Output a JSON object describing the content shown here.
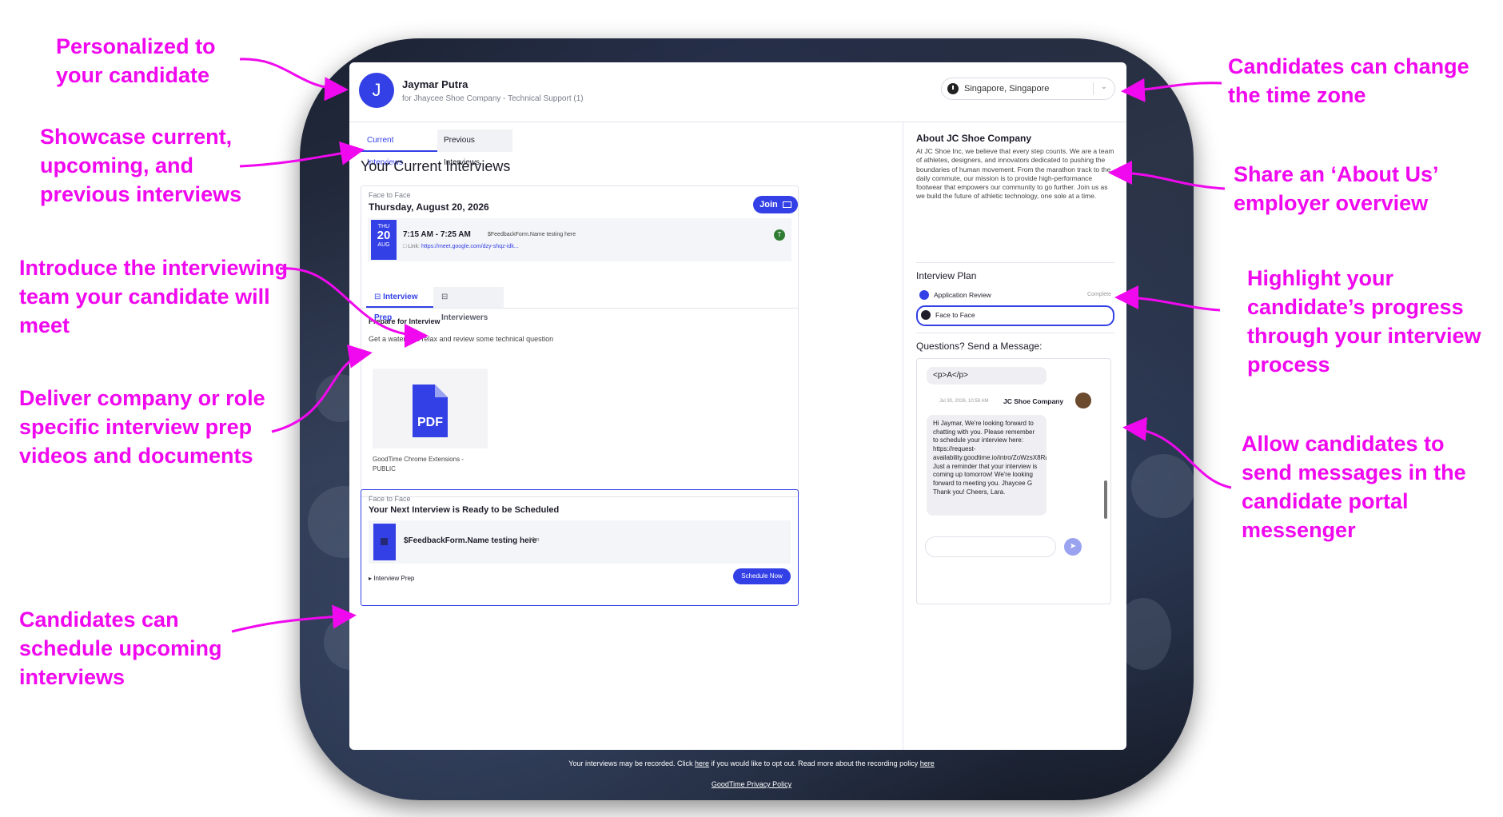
{
  "annotations": {
    "personalized": "Personalized to your candidate",
    "showcase": "Showcase current, upcoming, and previous interviews",
    "introduce": "Introduce the interviewing team your candidate will meet",
    "deliver": "Deliver company or role specific interview prep videos and documents",
    "schedule": "Candidates can schedule upcoming interviews",
    "timezone": "Candidates can change the time zone",
    "about": "Share an ‘About Us’ employer overview",
    "progress": "Highlight your candidate’s progress through your interview process",
    "messages": "Allow candidates to send messages in the candidate portal messenger"
  },
  "header": {
    "avatar_initial": "J",
    "candidate_name": "Jaymar Putra",
    "candidate_sub": "for Jhaycee Shoe Company - Technical Support (1)",
    "timezone": "Singapore, Singapore"
  },
  "tabs": [
    "Current Interviews",
    "Previous Interviews"
  ],
  "current_title": "Your Current Interviews",
  "interview_card": {
    "type": "Face to Face",
    "date": "Thursday, August 20, 2026",
    "join_label": "Join",
    "day_week": "THU",
    "day_num": "20",
    "day_month": "AUG",
    "time": "7:15 AM - 7:25 AM",
    "interviewer_name": "$FeedbackForm.Name testing here",
    "link_label": "Link:",
    "link": "https://meet.google.com/dzy-shqz-idk...",
    "interviewer_initial": "T"
  },
  "subtabs": [
    "Interview Prep",
    "Interviewers"
  ],
  "prep": {
    "title": "Prepare for Interview",
    "text": "Get a water and relax and review some technical question",
    "doc_icon_label": "PDF",
    "doc_name": "GoodTime Chrome Extensions - PUBLIC"
  },
  "next_card": {
    "type": "Face to Face",
    "title": "Your Next Interview is Ready to be Scheduled",
    "name": "$FeedbackForm.Name testing here",
    "duration": "10m",
    "prep_toggle": "Interview Prep",
    "schedule_label": "Schedule Now"
  },
  "about": {
    "title": "About JC Shoe Company",
    "text": "At JC Shoe Inc, we believe that every step counts. We are a team of athletes, designers, and innovators dedicated to pushing the boundaries of human movement. From the marathon track to the daily commute, our mission is to provide high-performance footwear that empowers our community to go further. Join us as we build the future of athletic technology, one sole at a time."
  },
  "plan": {
    "title": "Interview Plan",
    "steps": [
      {
        "label": "Application Review",
        "status": "Complete"
      },
      {
        "label": "Face to Face",
        "status": ""
      }
    ]
  },
  "messages": {
    "title": "Questions? Send a Message:",
    "first_bubble": "<p>A</p>",
    "meta_time": "Jul 30, 2026, 10:58 AM",
    "sender": "JC Shoe Company",
    "body": "Hi Jaymar, We're looking forward to chatting with you. Please remember to schedule your interview here: https://request-availability.goodtime.io/intro/ZoWzsX8RaM7rZdQq. Just a reminder that your interview is coming up tomorrow! We're looking forward to meeting you. Jhaycee G Thank you! Cheers, Lara."
  },
  "footer": {
    "record_pre": "Your interviews may be recorded. Click",
    "record_here1": "here",
    "record_mid": "if you would like to opt out. Read more about the recording policy",
    "record_here2": "here",
    "privacy": "GoodTime Privacy Policy"
  },
  "colors": {
    "accent": "#3340e6",
    "annotation": "#f008ee"
  }
}
